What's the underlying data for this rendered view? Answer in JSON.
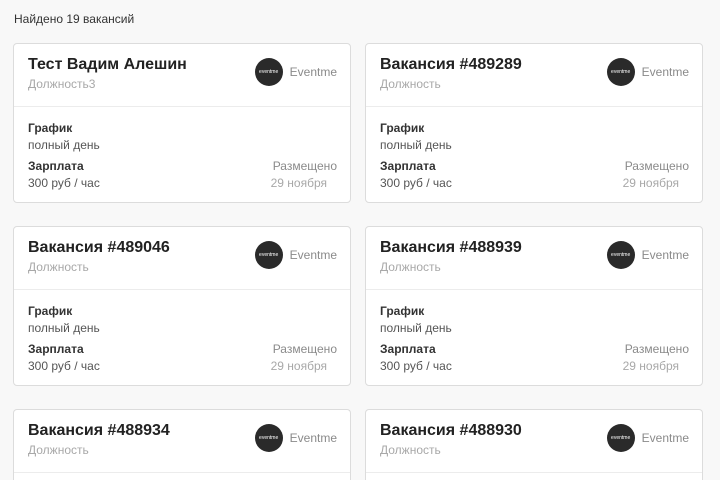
{
  "results": {
    "found_text": "Найдено 19 вакансий"
  },
  "cards": [
    {
      "title": "Тест Вадим Алешин",
      "position": "Должность3",
      "company": {
        "logo_text": "eventme",
        "name": "Eventme"
      },
      "schedule_label": "График",
      "schedule": "полный день",
      "salary_label": "Зарплата",
      "salary": "300 руб / час",
      "posted_label": "Размещено",
      "posted_date": "29 ноября"
    },
    {
      "title": "Вакансия #489289",
      "position": "Должность",
      "company": {
        "logo_text": "eventme",
        "name": "Eventme"
      },
      "schedule_label": "График",
      "schedule": "полный день",
      "salary_label": "Зарплата",
      "salary": "300 руб / час",
      "posted_label": "Размещено",
      "posted_date": "29 ноября"
    },
    {
      "title": "Вакансия #489046",
      "position": "Должность",
      "company": {
        "logo_text": "eventme",
        "name": "Eventme"
      },
      "schedule_label": "График",
      "schedule": "полный день",
      "salary_label": "Зарплата",
      "salary": "300 руб / час",
      "posted_label": "Размещено",
      "posted_date": "29 ноября"
    },
    {
      "title": "Вакансия #488939",
      "position": "Должность",
      "company": {
        "logo_text": "eventme",
        "name": "Eventme"
      },
      "schedule_label": "График",
      "schedule": "полный день",
      "salary_label": "Зарплата",
      "salary": "300 руб / час",
      "posted_label": "Размещено",
      "posted_date": "29 ноября"
    },
    {
      "title": "Вакансия #488934",
      "position": "Должность",
      "company": {
        "logo_text": "eventme",
        "name": "Eventme"
      }
    },
    {
      "title": "Вакансия #488930",
      "position": "Должность",
      "company": {
        "logo_text": "eventme",
        "name": "Eventme"
      }
    }
  ]
}
